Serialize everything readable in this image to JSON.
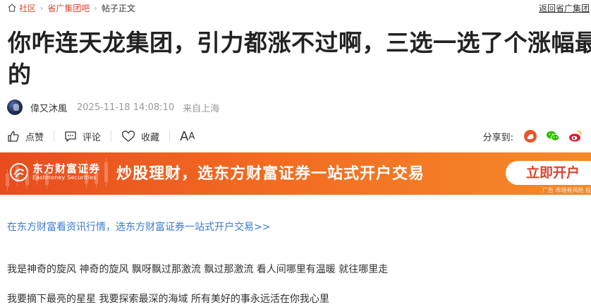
{
  "breadcrumb": {
    "items": [
      "社区",
      "省广集团吧",
      "帖子正文"
    ],
    "separator": "›"
  },
  "back_link": "返回省广集团",
  "post": {
    "title_line1": "你咋连天龙集团，引力都涨不过啊，三选一选了个涨幅最小",
    "title_line2": "的",
    "author": "偉又沐風",
    "timestamp": "2025-11-18 14:08:10",
    "location": "来自上海"
  },
  "actions": {
    "like": "点赞",
    "comment": "评论",
    "favorite": "收藏",
    "font_big": "A",
    "font_small": "A"
  },
  "share": {
    "label": "分享到:",
    "icons": [
      "weibo-circle-icon",
      "wechat-icon",
      "weibo-icon"
    ]
  },
  "banner": {
    "brand_cn": "东方财富证券",
    "brand_en": "Eastmoney Securities",
    "slogan": "炒股理财，选东方财富证券一站式开户交易",
    "cta": "立即开户",
    "note": "广告 市场有风险 投",
    "colors": {
      "start": "#e84c1f",
      "end": "#f58a2a"
    }
  },
  "content": {
    "promo_link": "在东方财富看资讯行情，选东方财富证券一站式开户交易>>",
    "paragraphs": [
      "我是神奇的旋风 神奇的旋风 飘呀飘过那激流 飘过那激流 看人间哪里有温暖 就往哪里走",
      "我要摘下最亮的星星 我要探索最深的海域 所有美好的事永远活在你我心里"
    ]
  },
  "colors": {
    "accent": "#e0432f",
    "link": "#3a7bd5",
    "text": "#333333",
    "muted": "#999999"
  }
}
